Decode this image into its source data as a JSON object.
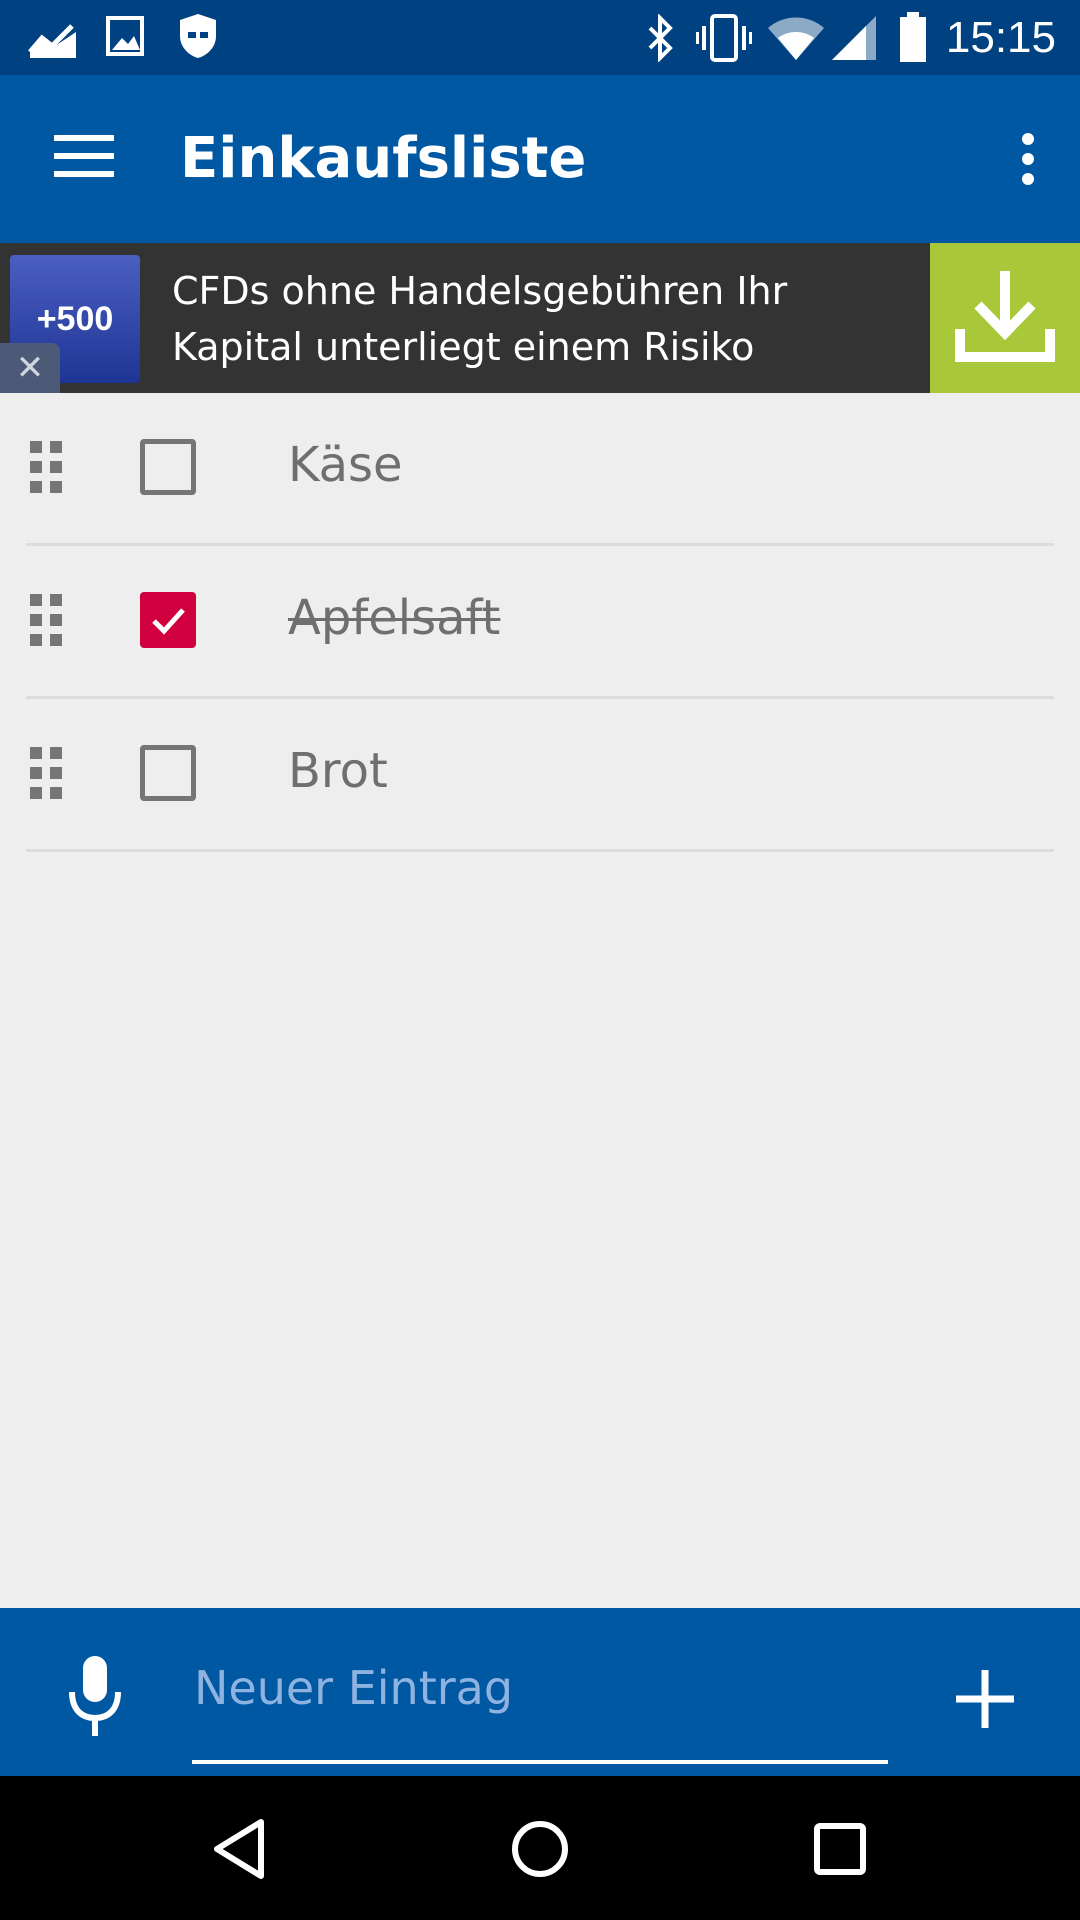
{
  "status_bar": {
    "time": "15:15",
    "left_icons": [
      "stock-chart-icon",
      "image-icon",
      "shield-icon"
    ],
    "right_icons": [
      "bluetooth-icon",
      "vibrate-icon",
      "wifi-icon",
      "signal-icon",
      "battery-icon"
    ]
  },
  "app_bar": {
    "title": "Einkaufsliste",
    "menu_icon": "hamburger-menu-icon",
    "overflow_icon": "more-vert-icon",
    "color": "#0058a3"
  },
  "ad": {
    "logo_text": "+500",
    "close_glyph": "✕",
    "text": "CFDs ohne Handelsgebühren Ihr Kapital unterliegt einem Risiko",
    "download_icon": "download-icon",
    "cta_color": "#a8c83a"
  },
  "list": {
    "items": [
      {
        "label": "Käse",
        "checked": false
      },
      {
        "label": "Apfelsaft",
        "checked": true
      },
      {
        "label": "Brot",
        "checked": false
      }
    ],
    "check_color": "#d0003f"
  },
  "input_bar": {
    "placeholder": "Neuer Eintrag",
    "mic_icon": "microphone-icon",
    "add_icon": "plus-icon"
  },
  "nav_bar": {
    "icons": [
      "back-icon",
      "home-icon",
      "recents-icon"
    ]
  }
}
